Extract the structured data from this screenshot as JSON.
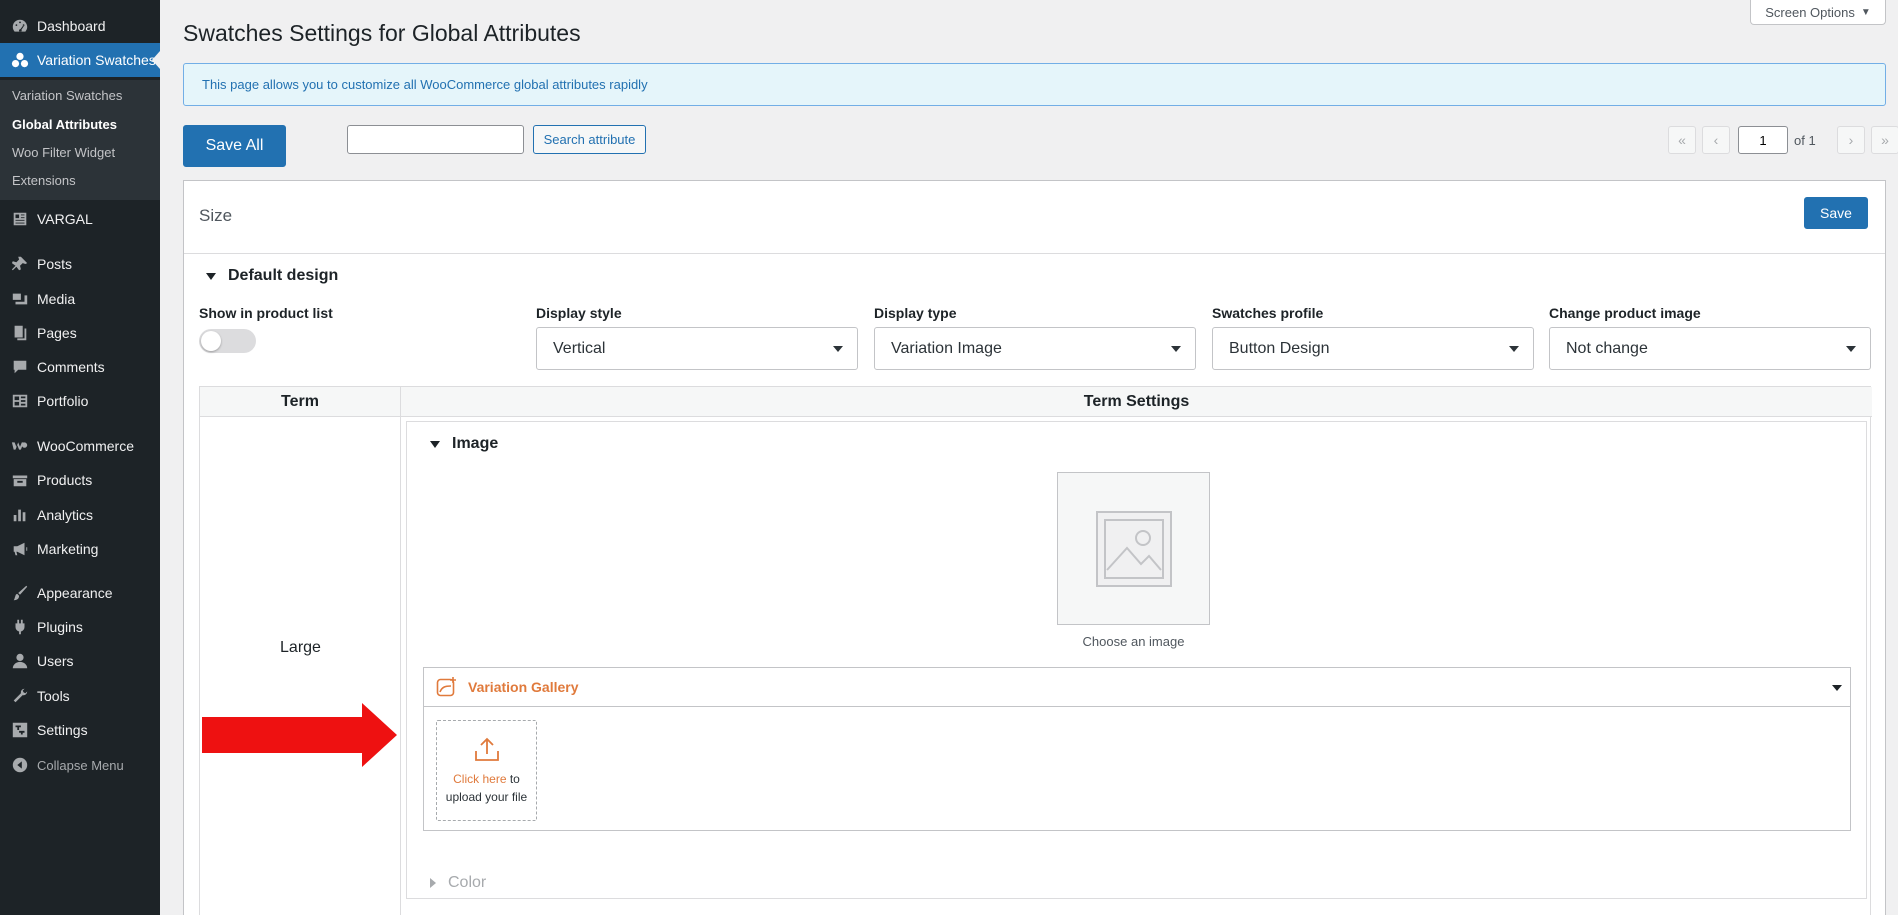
{
  "sidebar": {
    "items": [
      {
        "label": "Dashboard",
        "icon": "dashboard-icon"
      },
      {
        "label": "Variation Swatches",
        "icon": "swatches-icon",
        "current": true
      },
      {
        "label": "VARGAL",
        "icon": "vargal-icon"
      },
      {
        "label": "Posts",
        "icon": "pin-icon"
      },
      {
        "label": "Media",
        "icon": "media-icon"
      },
      {
        "label": "Pages",
        "icon": "pages-icon"
      },
      {
        "label": "Comments",
        "icon": "comments-icon"
      },
      {
        "label": "Portfolio",
        "icon": "portfolio-icon"
      },
      {
        "label": "WooCommerce",
        "icon": "woocommerce-icon"
      },
      {
        "label": "Products",
        "icon": "products-icon"
      },
      {
        "label": "Analytics",
        "icon": "analytics-icon"
      },
      {
        "label": "Marketing",
        "icon": "megaphone-icon"
      },
      {
        "label": "Appearance",
        "icon": "brush-icon"
      },
      {
        "label": "Plugins",
        "icon": "plugin-icon"
      },
      {
        "label": "Users",
        "icon": "users-icon"
      },
      {
        "label": "Tools",
        "icon": "wrench-icon"
      },
      {
        "label": "Settings",
        "icon": "settings-icon"
      }
    ],
    "submenu": [
      "Variation Swatches",
      "Global Attributes",
      "Woo Filter Widget",
      "Extensions"
    ],
    "submenu_active": "Global Attributes",
    "collapse_label": "Collapse Menu"
  },
  "page": {
    "title": "Swatches Settings for Global Attributes",
    "screen_options": "Screen Options",
    "notice": "This page allows you to customize all WooCommerce global attributes rapidly",
    "save_all": "Save All",
    "search_value": "",
    "search_button": "Search attribute",
    "pagination": {
      "first": "«",
      "prev": "‹",
      "current": "1",
      "of": "of 1",
      "next": "›",
      "last": "»"
    }
  },
  "attribute": {
    "name": "Size",
    "save": "Save",
    "default_design": "Default design",
    "fields": {
      "show_in_product_list": {
        "label": "Show in product list",
        "enabled": false
      },
      "display_style": {
        "label": "Display style",
        "value": "Vertical"
      },
      "display_type": {
        "label": "Display type",
        "value": "Variation Image"
      },
      "swatches_profile": {
        "label": "Swatches profile",
        "value": "Button Design"
      },
      "change_product_image": {
        "label": "Change product image",
        "value": "Not change"
      }
    },
    "table": {
      "col_term": "Term",
      "col_settings": "Term Settings",
      "term": "Large",
      "image_section": "Image",
      "choose_image": "Choose an image",
      "gallery": {
        "title": "Variation Gallery",
        "upload_link": "Click here",
        "upload_rest": " to",
        "upload_line2": "upload your file"
      },
      "color_section": "Color"
    }
  },
  "colors": {
    "accent": "#2271b1",
    "sidebar": "#1d2327",
    "gallery_orange": "#e07a3c",
    "annotation_arrow": "#ee1111"
  }
}
